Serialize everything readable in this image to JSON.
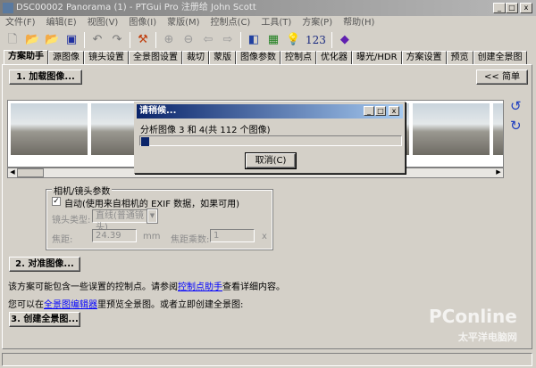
{
  "window": {
    "title": "DSC00002 Panorama (1) - PTGui Pro 注册给 John Scott",
    "controls": [
      "_",
      "□",
      "x"
    ]
  },
  "menu": [
    "文件(F)",
    "编辑(E)",
    "视图(V)",
    "图像(I)",
    "蒙版(M)",
    "控制点(C)",
    "工具(T)",
    "方案(P)",
    "帮助(H)"
  ],
  "toolbar": {
    "icons": [
      "new-icon",
      "open-icon",
      "open-images-icon",
      "save-icon",
      "undo-icon",
      "redo-icon",
      "tools-icon",
      "zoom-in-icon",
      "zoom-out-icon",
      "back-icon",
      "forward-icon",
      "panorama-editor-icon",
      "table-icon",
      "tip-icon",
      "numbers-icon",
      "help-book-icon"
    ],
    "numbers_label": "123"
  },
  "tabs": [
    "方案助手",
    "源图像",
    "镜头设置",
    "全景图设置",
    "裁切",
    "蒙版",
    "图像参数",
    "控制点",
    "优化器",
    "曝光/HDR",
    "方案设置",
    "预览",
    "创建全景图"
  ],
  "assistant": {
    "load_button": "1. 加载图像...",
    "simple_button": "<< 简单",
    "group_title": "相机/镜头参数",
    "auto_checkbox": "自动(使用来自相机的 EXIF 数据，如果可用)",
    "lens_type_label": "镜头类型:",
    "lens_type_value": "直线(普通镜头)",
    "focal_label": "焦距:",
    "focal_value": "24.39",
    "focal_unit": "mm",
    "multiplier_label": "焦距乘数:",
    "multiplier_value": "1",
    "multiplier_unit": "x",
    "align_button": "2. 对准图像...",
    "msg1_pre": "该方案可能包含一些误置的控制点。请参阅",
    "msg1_link": "控制点助手",
    "msg1_post": "查看详细内容。",
    "msg2_pre": "您可以在",
    "msg2_link": "全景图编辑器",
    "msg2_post": "里预览全景图。或者立即创建全景图:",
    "create_button": "3. 创建全景图..."
  },
  "dialog": {
    "title": "请稍候...",
    "message": "分析图像 3 和 4(共 112 个图像)",
    "progress": 0.03,
    "cancel": "取消(C)"
  },
  "watermark": "PConline 太平洋电脑网"
}
